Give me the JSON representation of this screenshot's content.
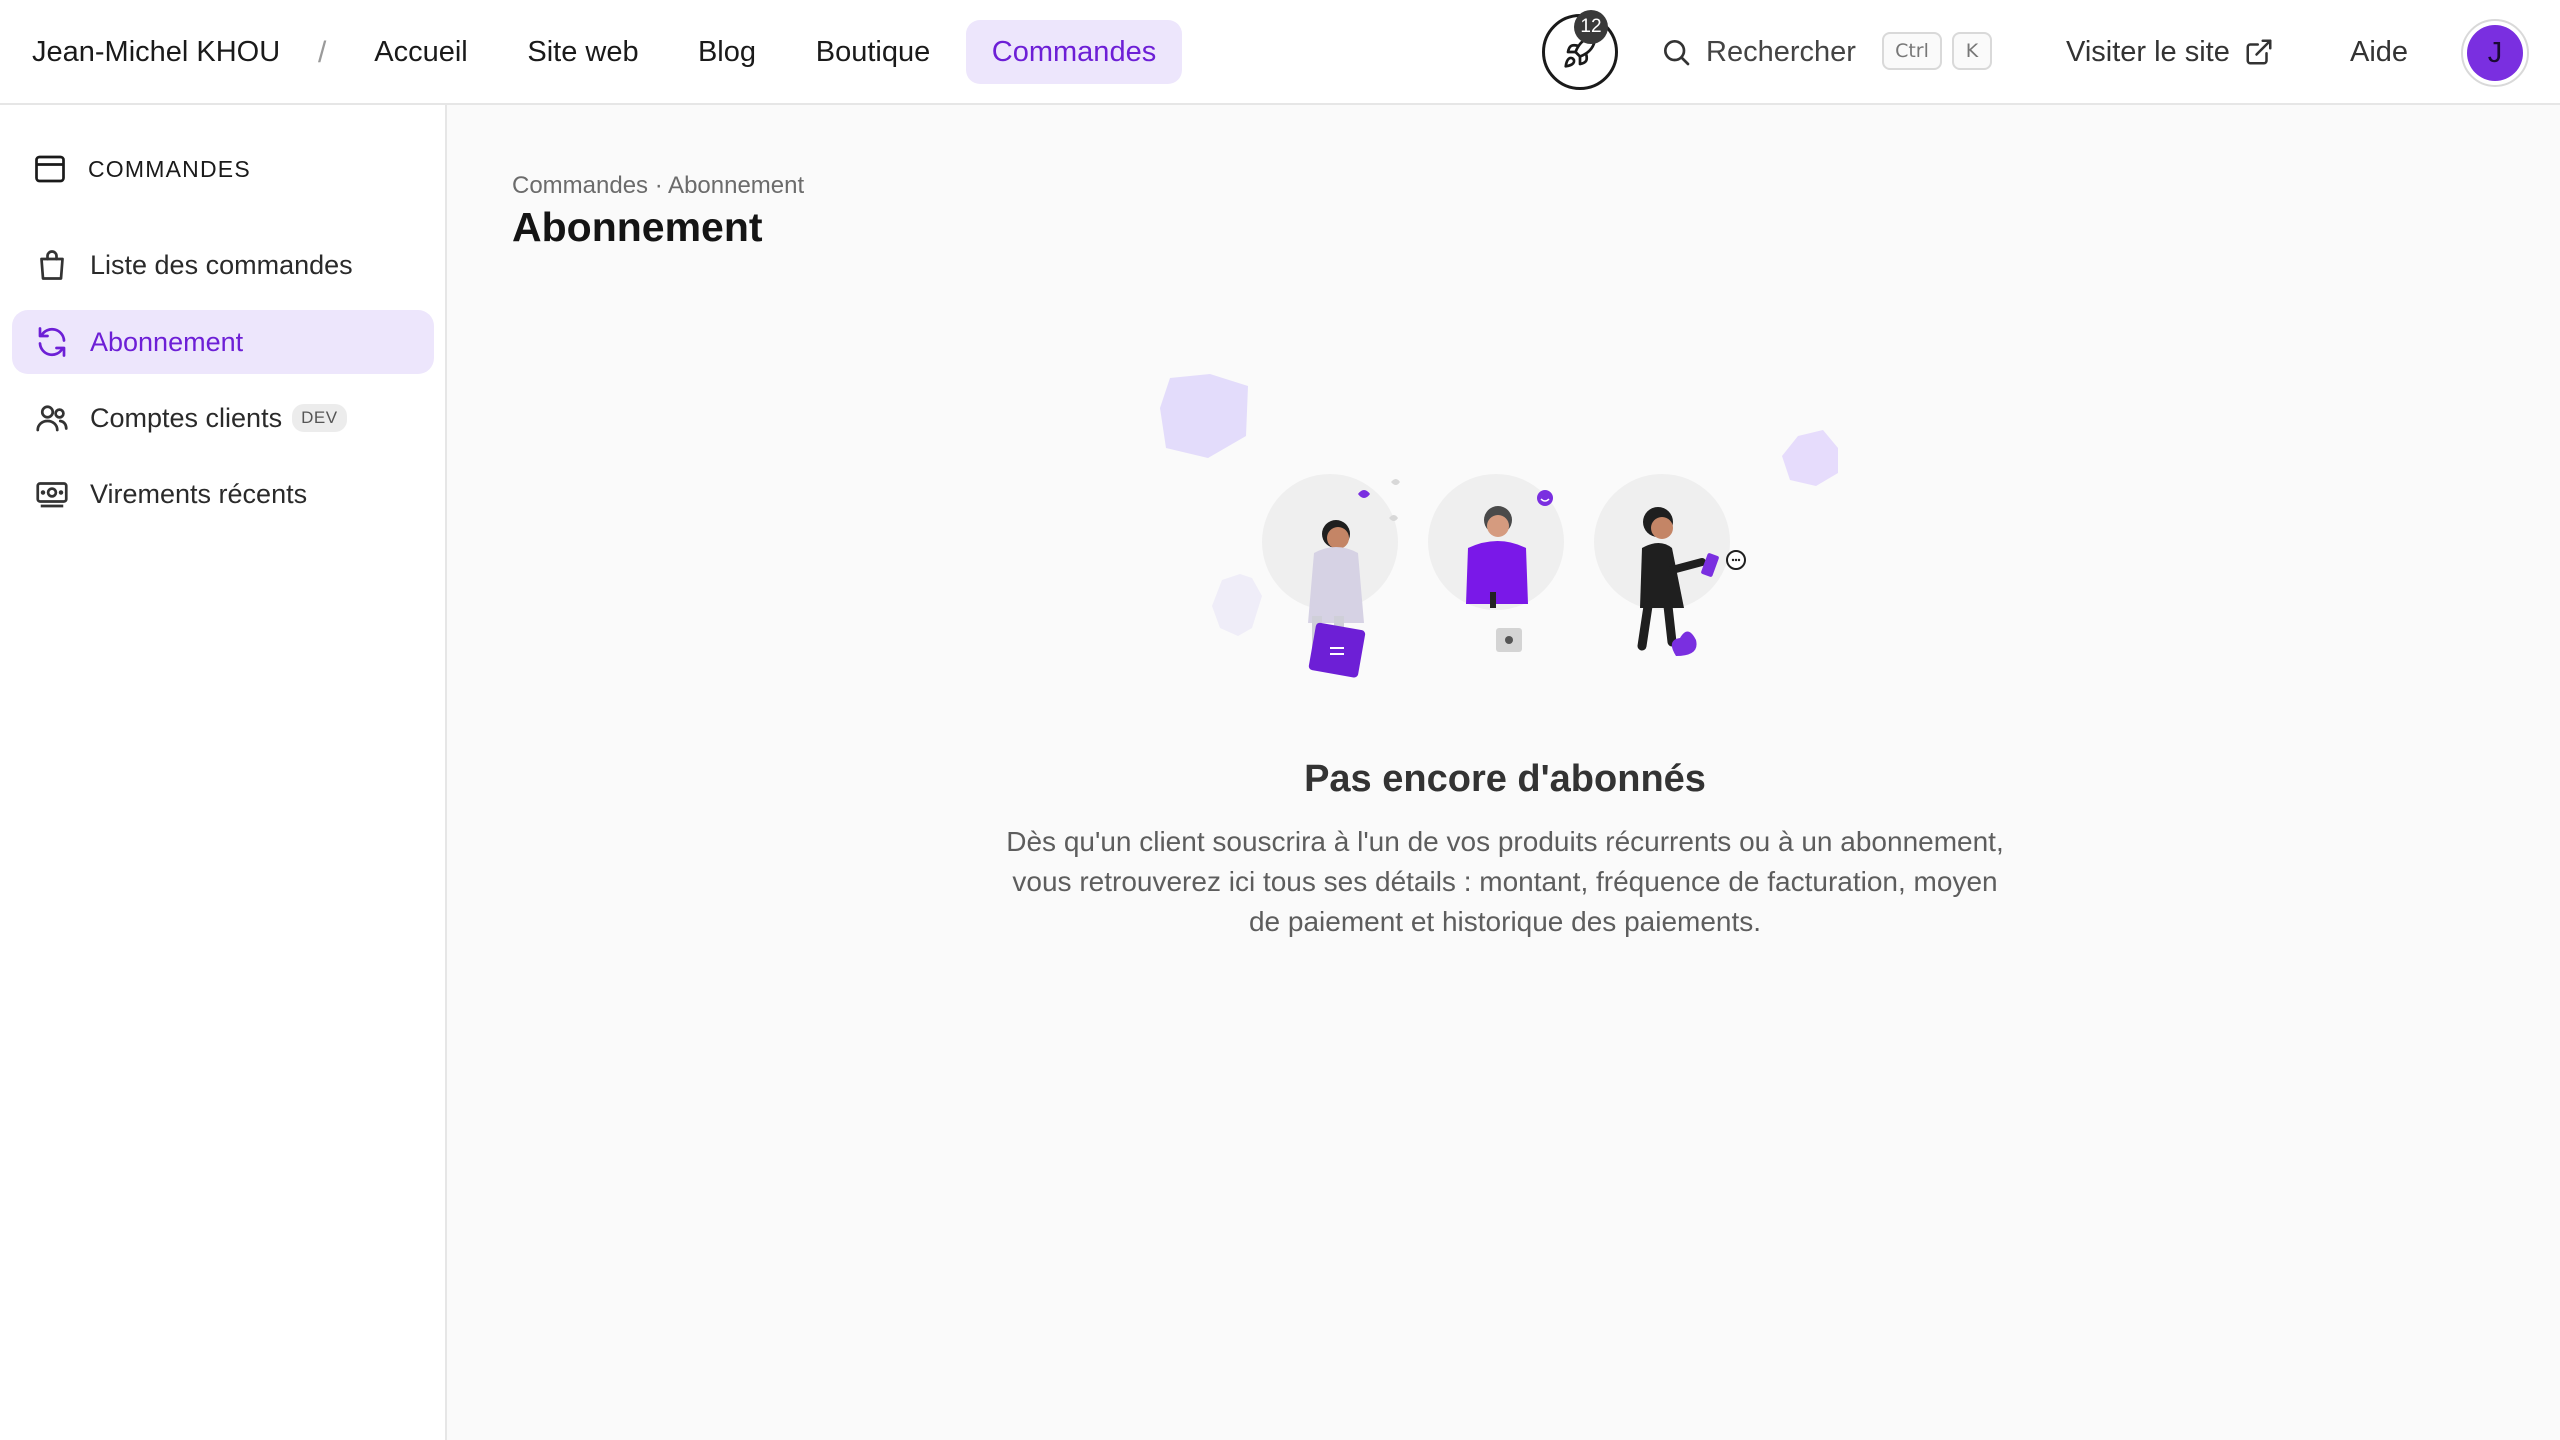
{
  "topbar": {
    "workspace": "Jean-Michel KHOU",
    "separator": "/",
    "nav": [
      {
        "label": "Accueil"
      },
      {
        "label": "Site web"
      },
      {
        "label": "Blog"
      },
      {
        "label": "Boutique"
      },
      {
        "label": "Commandes",
        "active": true
      }
    ],
    "notifications_count": "12",
    "search_label": "Rechercher",
    "search_shortcut": [
      "Ctrl",
      "K"
    ],
    "visit_site_label": "Visiter le site",
    "help_label": "Aide",
    "avatar_initial": "J"
  },
  "sidebar": {
    "section_title": "COMMANDES",
    "items": [
      {
        "label": "Liste des commandes",
        "icon": "shopping-bag-icon"
      },
      {
        "label": "Abonnement",
        "icon": "refresh-icon",
        "active": true
      },
      {
        "label": "Comptes clients",
        "icon": "users-icon",
        "badge": "DEV"
      },
      {
        "label": "Virements récents",
        "icon": "banknote-icon"
      }
    ]
  },
  "main": {
    "breadcrumb": "Commandes · Abonnement",
    "title": "Abonnement",
    "empty_state": {
      "title": "Pas encore d'abonnés",
      "description": "Dès qu'un client souscrira à l'un de vos produits récurrents ou à un abonnement, vous retrouverez ici tous ses détails : montant, fréquence de facturation, moyen de paiement et historique des paiements."
    }
  },
  "colors": {
    "accent": "#6d1fd6",
    "accent_soft": "#ede6fc",
    "avatar": "#7a2fe0",
    "border": "#e6e6e6",
    "background": "#fafafa"
  }
}
